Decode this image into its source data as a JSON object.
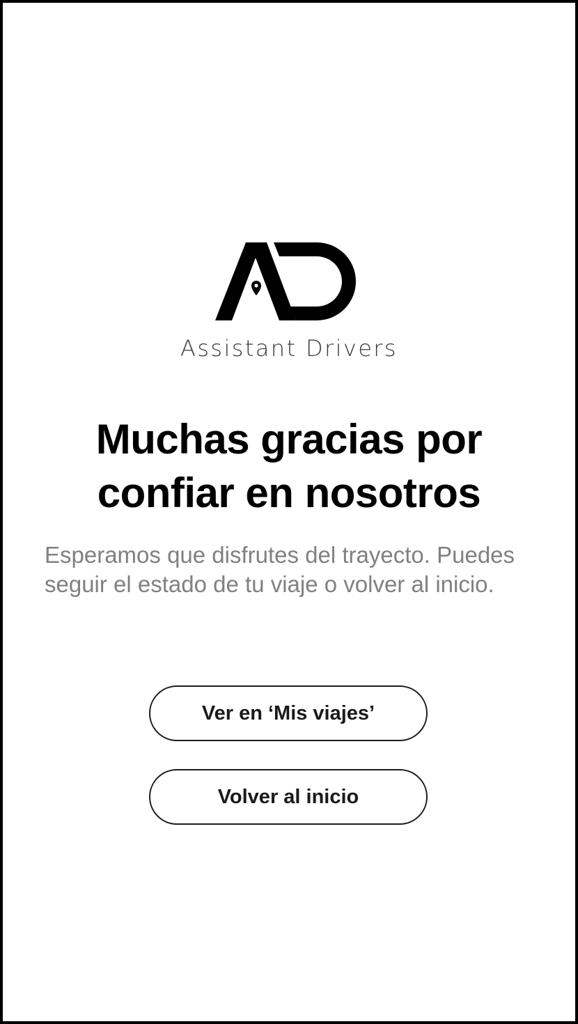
{
  "brand": {
    "logo_icon": "ad-logo-with-location-pin",
    "name": "Assistant Drivers"
  },
  "confirmation": {
    "title": "Muchas gracias por confiar en nosotros",
    "message": "Esperamos que disfrutes del trayecto. Puedes seguir el estado de tu viaje o volver al inicio."
  },
  "actions": {
    "view_trips_label": "Ver en ‘Mis viajes’",
    "home_label": "Volver al inicio"
  },
  "colors": {
    "text_primary": "#000000",
    "text_secondary": "#808080",
    "button_border": "#1c1c1c",
    "background": "#ffffff"
  }
}
